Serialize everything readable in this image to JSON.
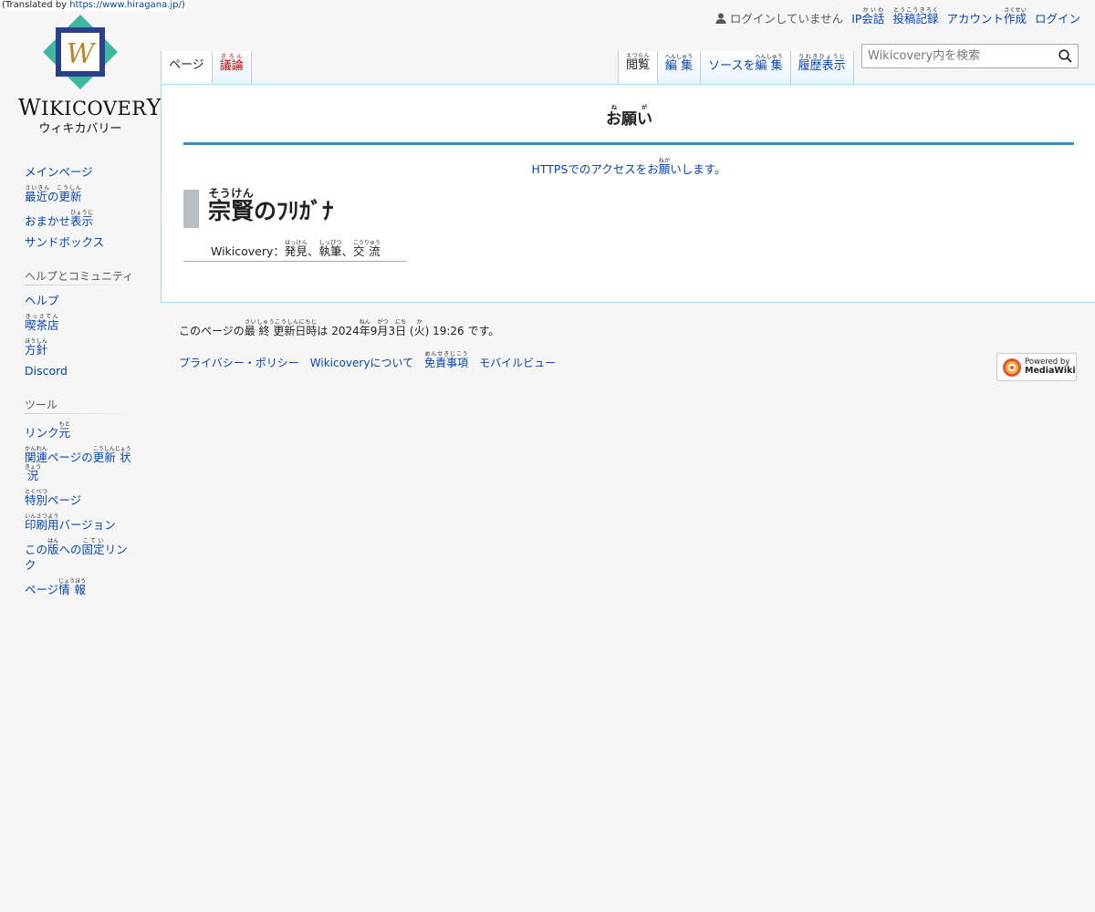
{
  "translated": {
    "prefix": "(Translated by ",
    "link": "https://www.hiragana.jp/",
    "suffix": ")"
  },
  "logo": {
    "letter": "W",
    "word_first": "W",
    "word_mid": "IKICOVER",
    "word_last": "Y",
    "subtitle": "ウィキカバリー"
  },
  "personal": {
    "not_logged_in": "ログインしていません",
    "ip_talk": {
      "base": "IP",
      "kanji": "会話",
      "ruby": "かいわ"
    },
    "contributions": {
      "kanji": "投稿記録",
      "ruby": "とうこうきろく"
    },
    "create_account": {
      "kana": "アカウント",
      "kanji": "作成",
      "ruby": "さくせい"
    },
    "login": "ログイン"
  },
  "tabs": {
    "page": "ページ",
    "talk": {
      "kanji": "議論",
      "ruby": "ぎろん"
    },
    "read": {
      "kanji": "閲覧",
      "ruby": "えつらん"
    },
    "edit": {
      "kanji": "編 集",
      "ruby": "へんしゅう"
    },
    "edit_source": {
      "kana": "ソースを",
      "kanji": "編 集",
      "ruby": "へんしゅう"
    },
    "history": {
      "kanji": "履歴表示",
      "ruby": "りれきひょうじ"
    }
  },
  "search": {
    "placeholder": "Wikicovery内を検索"
  },
  "notice": {
    "title_kanji": "お願い",
    "title_ruby": "ねが",
    "link_pre": "HTTPSでのアクセスをお",
    "link_kanji": "願",
    "link_ruby": "ねが",
    "link_post": "いします。"
  },
  "page": {
    "title_kanji": "宗賢",
    "title_ruby": "そうけん",
    "title_rest": "のﾌﾘｶﾞﾅ",
    "tagline": {
      "prefix": "Wikicovery：",
      "w1": "発見",
      "r1": "はっけん",
      "sep1": "、",
      "w2": "執筆",
      "r2": "しっぴつ",
      "sep2": "、",
      "w3": "交 流",
      "r3": "こうりゅう"
    }
  },
  "sidebar": {
    "nav": [
      {
        "text": "メインページ"
      },
      {
        "kanji": "最近の更新",
        "ruby": "さいきん　こうしん"
      },
      {
        "pre": "おまかせ",
        "kanji": "表示",
        "ruby": "ひょうじ"
      },
      {
        "text": "サンドボックス"
      }
    ],
    "community_head": "ヘルプとコミュニティ",
    "community": [
      {
        "text": "ヘルプ"
      },
      {
        "kanji": "喫茶店",
        "ruby": "きっさてん"
      },
      {
        "kanji": "方針",
        "ruby": "ほうしん"
      },
      {
        "text": "Discord"
      }
    ],
    "tools_head": "ツール",
    "tools": [
      {
        "pre": "リンク",
        "kanji": "元",
        "ruby": "もと"
      },
      {
        "kanji": "関連",
        "ruby": "かんれん",
        "mid": "ページの",
        "kanji2": "更新 状況",
        "ruby2": "こうしんじょうきょう"
      },
      {
        "kanji": "特別",
        "ruby": "とくべつ",
        "post": "ページ"
      },
      {
        "kanji": "印刷用",
        "ruby": "いんさつよう",
        "post": "バージョン"
      },
      {
        "pre": "この",
        "kanji": "版",
        "ruby": "はん",
        "mid": "への",
        "kanji2": "固定",
        "ruby2": "こてい",
        "post": "リンク"
      },
      {
        "pre": "ページ",
        "kanji": "情 報",
        "ruby": "じょうほう"
      }
    ]
  },
  "footer": {
    "lastmod_pre": "このページの",
    "lastmod_kanji": "最 終 更新日時",
    "lastmod_ruby": "さいしゅうこうしんにちじ",
    "lastmod_mid": "は 2024",
    "year": "年",
    "year_ruby": "ねん",
    "month_num": "9",
    "month": "月",
    "month_ruby": "がつ",
    "day_num": "3",
    "day": "日",
    "day_ruby": "にち",
    "open": " (",
    "weekday": "火",
    "weekday_ruby": "か",
    "close": ") 19:26 です。",
    "links": {
      "privacy": "プライバシー・ポリシー",
      "about": "Wikicoveryについて",
      "disclaimer": "免責事項",
      "disclaimer_ruby": "めんせきじこう",
      "mobile": "モバイルビュー"
    },
    "powered_by": "Powered by",
    "mediawiki": "MediaWiki"
  },
  "colors": {
    "link": "#0645ad",
    "talk_red": "#ba0000",
    "notice_line": "#3a8ac4",
    "content_border": "#a7d7f9"
  }
}
